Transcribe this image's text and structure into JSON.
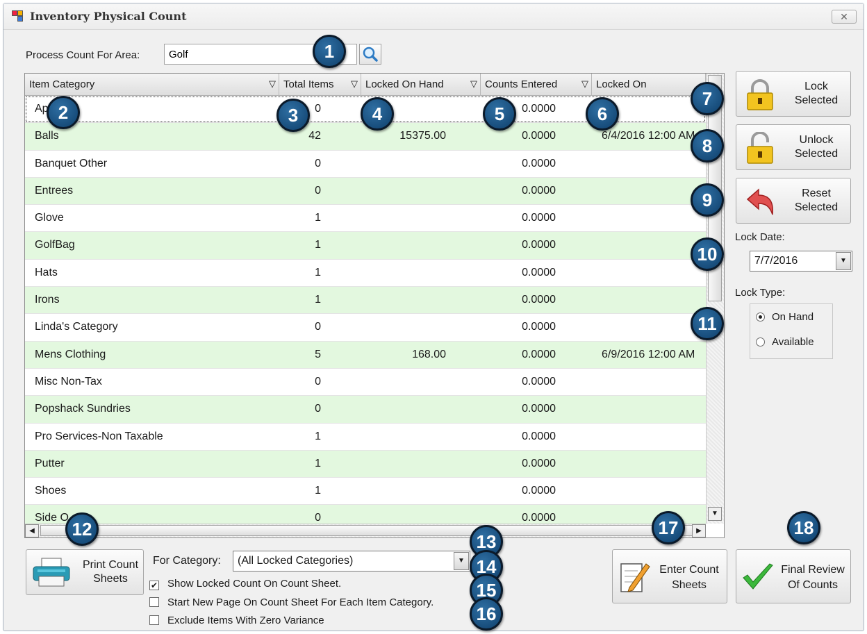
{
  "window": {
    "title": "Inventory Physical Count",
    "close_label": "✕"
  },
  "area": {
    "label": "Process Count For Area:",
    "value": "Golf"
  },
  "grid": {
    "columns": [
      "Item Category",
      "Total Items",
      "Locked On Hand",
      "Counts Entered",
      "Locked On"
    ],
    "rows": [
      {
        "category": "Ap",
        "total": "0",
        "on_hand": "",
        "counts": "0.0000",
        "locked_on": ""
      },
      {
        "category": "Balls",
        "total": "42",
        "on_hand": "15375.00",
        "counts": "0.0000",
        "locked_on": "6/4/2016 12:00 AM"
      },
      {
        "category": "Banquet Other",
        "total": "0",
        "on_hand": "",
        "counts": "0.0000",
        "locked_on": ""
      },
      {
        "category": "Entrees",
        "total": "0",
        "on_hand": "",
        "counts": "0.0000",
        "locked_on": ""
      },
      {
        "category": "Glove",
        "total": "1",
        "on_hand": "",
        "counts": "0.0000",
        "locked_on": ""
      },
      {
        "category": "GolfBag",
        "total": "1",
        "on_hand": "",
        "counts": "0.0000",
        "locked_on": ""
      },
      {
        "category": "Hats",
        "total": "1",
        "on_hand": "",
        "counts": "0.0000",
        "locked_on": ""
      },
      {
        "category": "Irons",
        "total": "1",
        "on_hand": "",
        "counts": "0.0000",
        "locked_on": ""
      },
      {
        "category": "Linda's Category",
        "total": "0",
        "on_hand": "",
        "counts": "0.0000",
        "locked_on": ""
      },
      {
        "category": "Mens Clothing",
        "total": "5",
        "on_hand": "168.00",
        "counts": "0.0000",
        "locked_on": "6/9/2016 12:00 AM"
      },
      {
        "category": "Misc Non-Tax",
        "total": "0",
        "on_hand": "",
        "counts": "0.0000",
        "locked_on": ""
      },
      {
        "category": "Popshack Sundries",
        "total": "0",
        "on_hand": "",
        "counts": "0.0000",
        "locked_on": ""
      },
      {
        "category": "Pro Services-Non Taxable",
        "total": "1",
        "on_hand": "",
        "counts": "0.0000",
        "locked_on": ""
      },
      {
        "category": "Putter",
        "total": "1",
        "on_hand": "",
        "counts": "0.0000",
        "locked_on": ""
      },
      {
        "category": "Shoes",
        "total": "1",
        "on_hand": "",
        "counts": "0.0000",
        "locked_on": ""
      },
      {
        "category": "Side O",
        "total": "0",
        "on_hand": "",
        "counts": "0.0000",
        "locked_on": ""
      }
    ]
  },
  "side": {
    "lock_label": "Lock Selected",
    "lock_line1": "Lock",
    "lock_line2": "Selected",
    "unlock_line1": "Unlock",
    "unlock_line2": "Selected",
    "reset_line1": "Reset",
    "reset_line2": "Selected",
    "lock_date_label": "Lock Date:",
    "lock_date_value": "7/7/2016",
    "lock_type_label": "Lock Type:",
    "lock_type_options": [
      "On Hand",
      "Available"
    ],
    "lock_type_selected": "On Hand"
  },
  "bottom": {
    "print_line1": "Print Count",
    "print_line2": "Sheets",
    "for_category_label": "For Category:",
    "for_category_value": "(All Locked Categories)",
    "checks": [
      {
        "label": "Show Locked Count On Count Sheet.",
        "checked": true
      },
      {
        "label": "Start New Page On Count Sheet For Each Item Category.",
        "checked": false
      },
      {
        "label": "Exclude Items With Zero Variance",
        "checked": false
      }
    ],
    "enter_line1": "Enter Count",
    "enter_line2": "Sheets",
    "final_line1": "Final Review",
    "final_line2": "Of Counts"
  },
  "badges": [
    "1",
    "2",
    "3",
    "4",
    "5",
    "6",
    "7",
    "8",
    "9",
    "10",
    "11",
    "12",
    "13",
    "14",
    "15",
    "16",
    "17",
    "18"
  ],
  "colors": {
    "row_alt": "#e3f8df",
    "badge": "#1b5687",
    "lock_gold": "#f2c420",
    "reset_red": "#e05050",
    "check_green": "#3cb83c"
  }
}
